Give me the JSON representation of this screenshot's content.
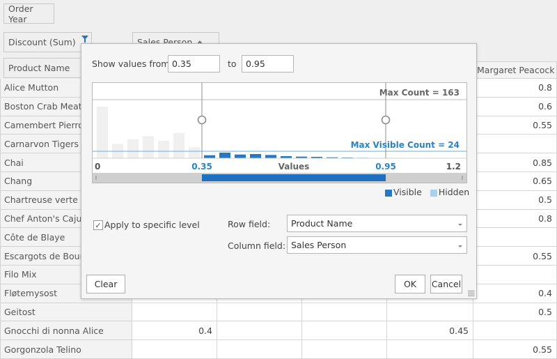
{
  "field_list": {
    "filter_area_field": "Order Year",
    "data_field": "Discount (Sum)",
    "column_field": "Sales Person",
    "row_field": "Product Name"
  },
  "grid": {
    "visible_column_header": "Margaret Peacock",
    "rows": [
      {
        "product": "Alice Mutton",
        "values": [
          "",
          "",
          "",
          "",
          "0.8"
        ]
      },
      {
        "product": "Boston Crab Meat",
        "values": [
          "",
          "",
          "",
          "",
          "0.6"
        ]
      },
      {
        "product": "Camembert Pierrot",
        "values": [
          "",
          "",
          "",
          "",
          "0.55"
        ]
      },
      {
        "product": "Carnarvon Tigers",
        "values": [
          "",
          "",
          "",
          "",
          ""
        ]
      },
      {
        "product": "Chai",
        "values": [
          "",
          "",
          "",
          "",
          "0.85"
        ]
      },
      {
        "product": "Chang",
        "values": [
          "",
          "",
          "",
          "",
          "0.65"
        ]
      },
      {
        "product": "Chartreuse verte",
        "values": [
          "",
          "",
          "",
          "",
          "0.5"
        ]
      },
      {
        "product": "Chef Anton's Cajun",
        "values": [
          "",
          "",
          "",
          "",
          "0.8"
        ]
      },
      {
        "product": "Côte de Blaye",
        "values": [
          "",
          "",
          "",
          "",
          ""
        ]
      },
      {
        "product": "Escargots de Bourg",
        "values": [
          "",
          "",
          "",
          "",
          "0.55"
        ]
      },
      {
        "product": "Filo Mix",
        "values": [
          "",
          "",
          "",
          "",
          ""
        ]
      },
      {
        "product": "Fløtemysost",
        "values": [
          "",
          "",
          "",
          "",
          "0.4"
        ]
      },
      {
        "product": "Geitost",
        "values": [
          "",
          "",
          "",
          "",
          "0.5"
        ]
      },
      {
        "product": "Gnocchi di nonna Alice",
        "values": [
          "0.4",
          "",
          "",
          "0.45",
          ""
        ]
      },
      {
        "product": "Gorgonzola Telino",
        "values": [
          "",
          "",
          "",
          "",
          "0.55"
        ]
      }
    ]
  },
  "dialog": {
    "show_values_label": "Show values from",
    "from_value": "0.35",
    "to_label": "to",
    "to_value": "0.95",
    "apply_level_label": "Apply to specific level",
    "apply_level_checked": true,
    "check_glyph": "✓",
    "row_field_label": "Row field:",
    "row_field_value": "Product Name",
    "column_field_label": "Column field:",
    "column_field_value": "Sales Person",
    "clear_label": "Clear",
    "ok_label": "OK",
    "cancel_label": "Cancel"
  },
  "chart_data": {
    "type": "bar",
    "title": "",
    "xlabel": "Values",
    "xlim": [
      0,
      1.2
    ],
    "x_ticks": [
      "0",
      "1.2"
    ],
    "range_from": 0.35,
    "range_to": 0.95,
    "range_from_label": "0.35",
    "range_to_label": "0.95",
    "max_count_label": "Max Count = 163",
    "max_visible_count_label": "Max Visible Count = 24",
    "max_count": 163,
    "max_visible_count": 24,
    "bins": [
      0.0,
      0.05,
      0.1,
      0.15,
      0.2,
      0.25,
      0.3,
      0.35,
      0.4,
      0.45,
      0.5,
      0.55,
      0.6,
      0.65,
      0.7,
      0.75,
      0.8,
      0.85,
      0.9
    ],
    "counts": [
      163,
      45,
      60,
      70,
      55,
      80,
      35,
      13,
      24,
      16,
      18,
      14,
      9,
      7,
      6,
      4,
      3,
      2,
      1
    ],
    "legend": [
      {
        "name": "Visible",
        "color": "#2678c2"
      },
      {
        "name": "Hidden",
        "color": "#a9d0ec"
      }
    ],
    "colors": {
      "visible": "#2678c2",
      "hidden": "#f0f0f0",
      "range_bar": "#1e6fbe",
      "accent_text": "#2a84c4",
      "max_count_text": "#666666"
    }
  }
}
